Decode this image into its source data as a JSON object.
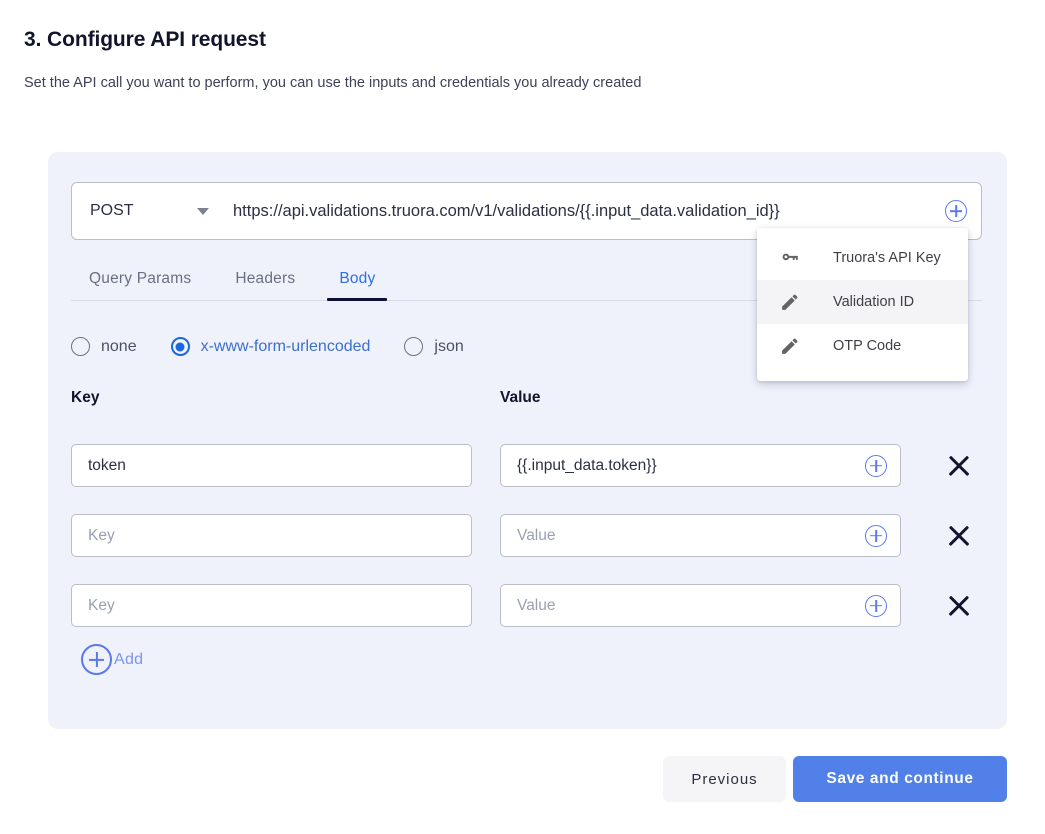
{
  "header": {
    "title": "3. Configure API request",
    "subtitle": "Set the API call you want to perform, you can use the inputs and credentials you already created"
  },
  "request": {
    "method": "POST",
    "url": "https://api.validations.truora.com/v1/validations/{{.input_data.validation_id}}",
    "insert_variable_icon": "plus-circle-icon"
  },
  "variable_menu": {
    "items": [
      {
        "label": "Truora's API Key",
        "icon": "key-icon",
        "hovered": false
      },
      {
        "label": "Validation ID",
        "icon": "pencil-icon",
        "hovered": true
      },
      {
        "label": "OTP Code",
        "icon": "pencil-icon",
        "hovered": false
      }
    ]
  },
  "tabs": [
    {
      "label": "Query Params",
      "active": false
    },
    {
      "label": "Headers",
      "active": false
    },
    {
      "label": "Body",
      "active": true
    }
  ],
  "body_type": {
    "options": [
      {
        "label": "none",
        "selected": false
      },
      {
        "label": "x-www-form-urlencoded",
        "selected": true
      },
      {
        "label": "json",
        "selected": false
      }
    ]
  },
  "kv_table": {
    "headers": {
      "key": "Key",
      "value": "Value"
    },
    "rows": [
      {
        "key": "token",
        "key_placeholder": "Key",
        "value": "{{.input_data.token}}",
        "value_placeholder": "Value"
      },
      {
        "key": "",
        "key_placeholder": "Key",
        "value": "",
        "value_placeholder": "Value"
      },
      {
        "key": "",
        "key_placeholder": "Key",
        "value": "",
        "value_placeholder": "Value"
      }
    ],
    "add_label": "Add"
  },
  "footer": {
    "previous_label": "Previous",
    "save_label": "Save and continue"
  },
  "colors": {
    "accent_blue": "#5180e8",
    "panel_bg": "#eff2fb",
    "tab_active": "#2f6fe4",
    "tab_underline": "#0d1136",
    "radio_selected": "#1867e0",
    "plus_icon": "#5b79ea"
  }
}
